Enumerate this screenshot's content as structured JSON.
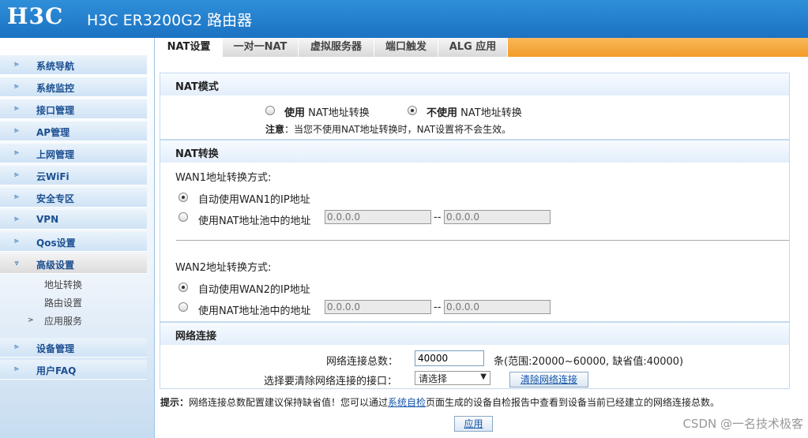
{
  "header": {
    "logo": "H3C",
    "title": "H3C ER3200G2 路由器"
  },
  "sidebar": {
    "items": [
      {
        "label": "系统导航"
      },
      {
        "label": "系统监控"
      },
      {
        "label": "接口管理"
      },
      {
        "label": "AP管理"
      },
      {
        "label": "上网管理"
      },
      {
        "label": "云WiFi"
      },
      {
        "label": "安全专区"
      },
      {
        "label": "VPN"
      },
      {
        "label": "Qos设置"
      },
      {
        "label": "高级设置"
      },
      {
        "label": "设备管理"
      },
      {
        "label": "用户FAQ"
      }
    ],
    "subitems": [
      {
        "label": "地址转换"
      },
      {
        "label": "路由设置"
      },
      {
        "label": "应用服务"
      }
    ]
  },
  "tabs": [
    {
      "label": "NAT设置"
    },
    {
      "label": "一对一NAT"
    },
    {
      "label": "虚拟服务器"
    },
    {
      "label": "端口触发"
    },
    {
      "label": "ALG 应用"
    }
  ],
  "nat_mode": {
    "title": "NAT模式",
    "use_bold": "使用",
    "use_rest": "NAT地址转换",
    "nouse_bold": "不使用",
    "nouse_rest": "NAT地址转换",
    "selected": "not_use",
    "note_bold": "注意",
    "note_text": "：当您不使用NAT地址转换时，NAT设置将不会生效。"
  },
  "nat_convert": {
    "title": "NAT转换",
    "wan1": {
      "label": "WAN1地址转换方式:",
      "auto": "自动使用WAN1的IP地址",
      "pool": "使用NAT地址池中的地址",
      "start": "0.0.0.0",
      "sep": "--",
      "end": "0.0.0.0"
    },
    "wan2": {
      "label": "WAN2地址转换方式:",
      "auto": "自动使用WAN2的IP地址",
      "pool": "使用NAT地址池中的地址",
      "start": "0.0.0.0",
      "sep": "--",
      "end": "0.0.0.0"
    }
  },
  "network": {
    "title": "网络连接",
    "total_label": "网络连接总数：",
    "total_value": "40000",
    "range_text": "条(范围:20000~60000, 缺省值:40000)",
    "clear_label": "选择要清除网络连接的接口：",
    "select_value": "请选择",
    "clear_button": "清除网络连接"
  },
  "tip": {
    "bold": "提示：",
    "before": "网络连接总数配置建议保持缺省值！您可以通过",
    "link": "系统自检",
    "after": "页面生成的设备自检报告中查看到设备当前已经建立的网络连接总数。"
  },
  "apply_button": "应用",
  "watermark": "CSDN @一名技术极客"
}
